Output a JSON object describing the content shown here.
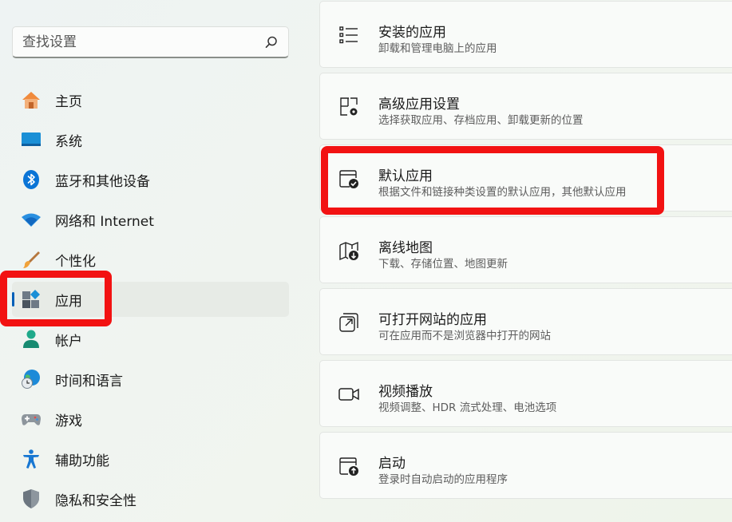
{
  "search": {
    "placeholder": "查找设置"
  },
  "sidebar": {
    "items": [
      {
        "label": "主页",
        "icon": "home-icon"
      },
      {
        "label": "系统",
        "icon": "system-icon"
      },
      {
        "label": "蓝牙和其他设备",
        "icon": "bluetooth-icon"
      },
      {
        "label": "网络和 Internet",
        "icon": "wifi-icon"
      },
      {
        "label": "个性化",
        "icon": "brush-icon"
      },
      {
        "label": "应用",
        "icon": "apps-icon",
        "selected": true
      },
      {
        "label": "帐户",
        "icon": "account-icon"
      },
      {
        "label": "时间和语言",
        "icon": "globe-clock-icon"
      },
      {
        "label": "游戏",
        "icon": "gamepad-icon"
      },
      {
        "label": "辅助功能",
        "icon": "accessibility-icon"
      },
      {
        "label": "隐私和安全性",
        "icon": "shield-icon"
      }
    ]
  },
  "main": {
    "cards": [
      {
        "title": "安装的应用",
        "subtitle": "卸载和管理电脑上的应用",
        "icon": "list-icon"
      },
      {
        "title": "高级应用设置",
        "subtitle": "选择获取应用、存档应用、卸载更新的位置",
        "icon": "app-settings-icon"
      },
      {
        "title": "默认应用",
        "subtitle": "根据文件和链接种类设置的默认应用，其他默认应用",
        "icon": "default-apps-icon"
      },
      {
        "title": "离线地图",
        "subtitle": "下载、存储位置、地图更新",
        "icon": "map-download-icon"
      },
      {
        "title": "可打开网站的应用",
        "subtitle": "可在应用而不是浏览器中打开的网站",
        "icon": "open-external-icon"
      },
      {
        "title": "视频播放",
        "subtitle": "视频调整、HDR 流式处理、电池选项",
        "icon": "video-icon"
      },
      {
        "title": "启动",
        "subtitle": "登录时自动启动的应用程序",
        "icon": "startup-icon"
      }
    ]
  },
  "colors": {
    "highlight": "#f21212",
    "accent": "#005fb8"
  }
}
